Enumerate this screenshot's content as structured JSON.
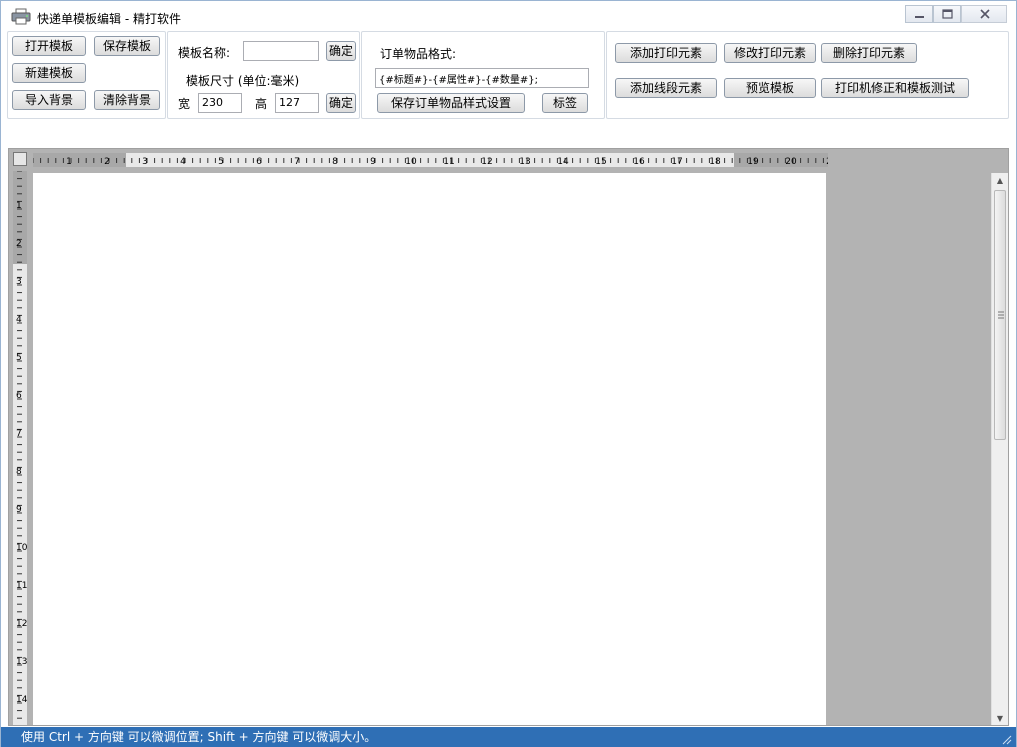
{
  "window": {
    "title": "快递单模板编辑 - 精打软件"
  },
  "file_panel": {
    "open_template": "打开模板",
    "save_template": "保存模板",
    "new_template": "新建模板",
    "import_background": "导入背景",
    "clear_background": "清除背景"
  },
  "template_panel": {
    "name_label": "模板名称:",
    "name_value": "",
    "confirm_name": "确定",
    "size_label": "模板尺寸  (单位:毫米)",
    "width_label": "宽",
    "width_value": "230",
    "height_label": "高",
    "height_value": "127",
    "confirm_size": "确定"
  },
  "format_panel": {
    "format_label": "订单物品格式:",
    "format_value": "{#标题#}-{#属性#}-{#数量#};",
    "save_format": "保存订单物品样式设置",
    "tag_button": "标签"
  },
  "element_panel": {
    "add_print_element": "添加打印元素",
    "edit_print_element": "修改打印元素",
    "delete_print_element": "删除打印元素",
    "add_line_element": "添加线段元素",
    "preview_template": "预览模板",
    "printer_calibration": "打印机修正和模板测试"
  },
  "ruler": {
    "h_labels": [
      "1",
      "2",
      "3",
      "4",
      "5",
      "6",
      "7",
      "8",
      "9",
      "10",
      "11",
      "12",
      "13",
      "14",
      "15",
      "16",
      "17",
      "18",
      "19",
      "20",
      "2"
    ],
    "v_labels": [
      "1",
      "2",
      "3",
      "4",
      "5",
      "6",
      "7",
      "8",
      "9",
      "10",
      "11",
      "12",
      "13",
      "14"
    ]
  },
  "status": {
    "hint": "使用 Ctrl + 方向键 可以微调位置; Shift + 方向键 可以微调大小。"
  },
  "colors": {
    "status_bar": "#2f6fb5",
    "editor_background": "#b3b3b3"
  }
}
